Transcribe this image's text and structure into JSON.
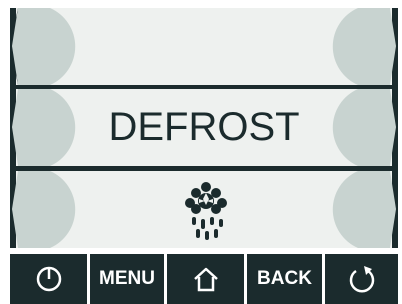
{
  "main": {
    "title": "DEFROST",
    "center_icon": "defrost-icon"
  },
  "side_buttons": {
    "left": [
      "left-arrow-icon",
      "left-arrow-icon",
      "left-arrow-icon"
    ],
    "right": [
      "right-arrow-icon",
      "right-arrow-icon",
      "right-arrow-icon"
    ]
  },
  "bottom_bar": {
    "power_icon": "power-icon",
    "menu_label": "MENU",
    "home_icon": "home-icon",
    "back_label": "BACK",
    "refresh_icon": "refresh-icon"
  },
  "colors": {
    "dark": "#1b2b2d",
    "row_bg": "#eef1ef",
    "bubble": "#c8d3d0",
    "text_light": "#ffffff"
  }
}
